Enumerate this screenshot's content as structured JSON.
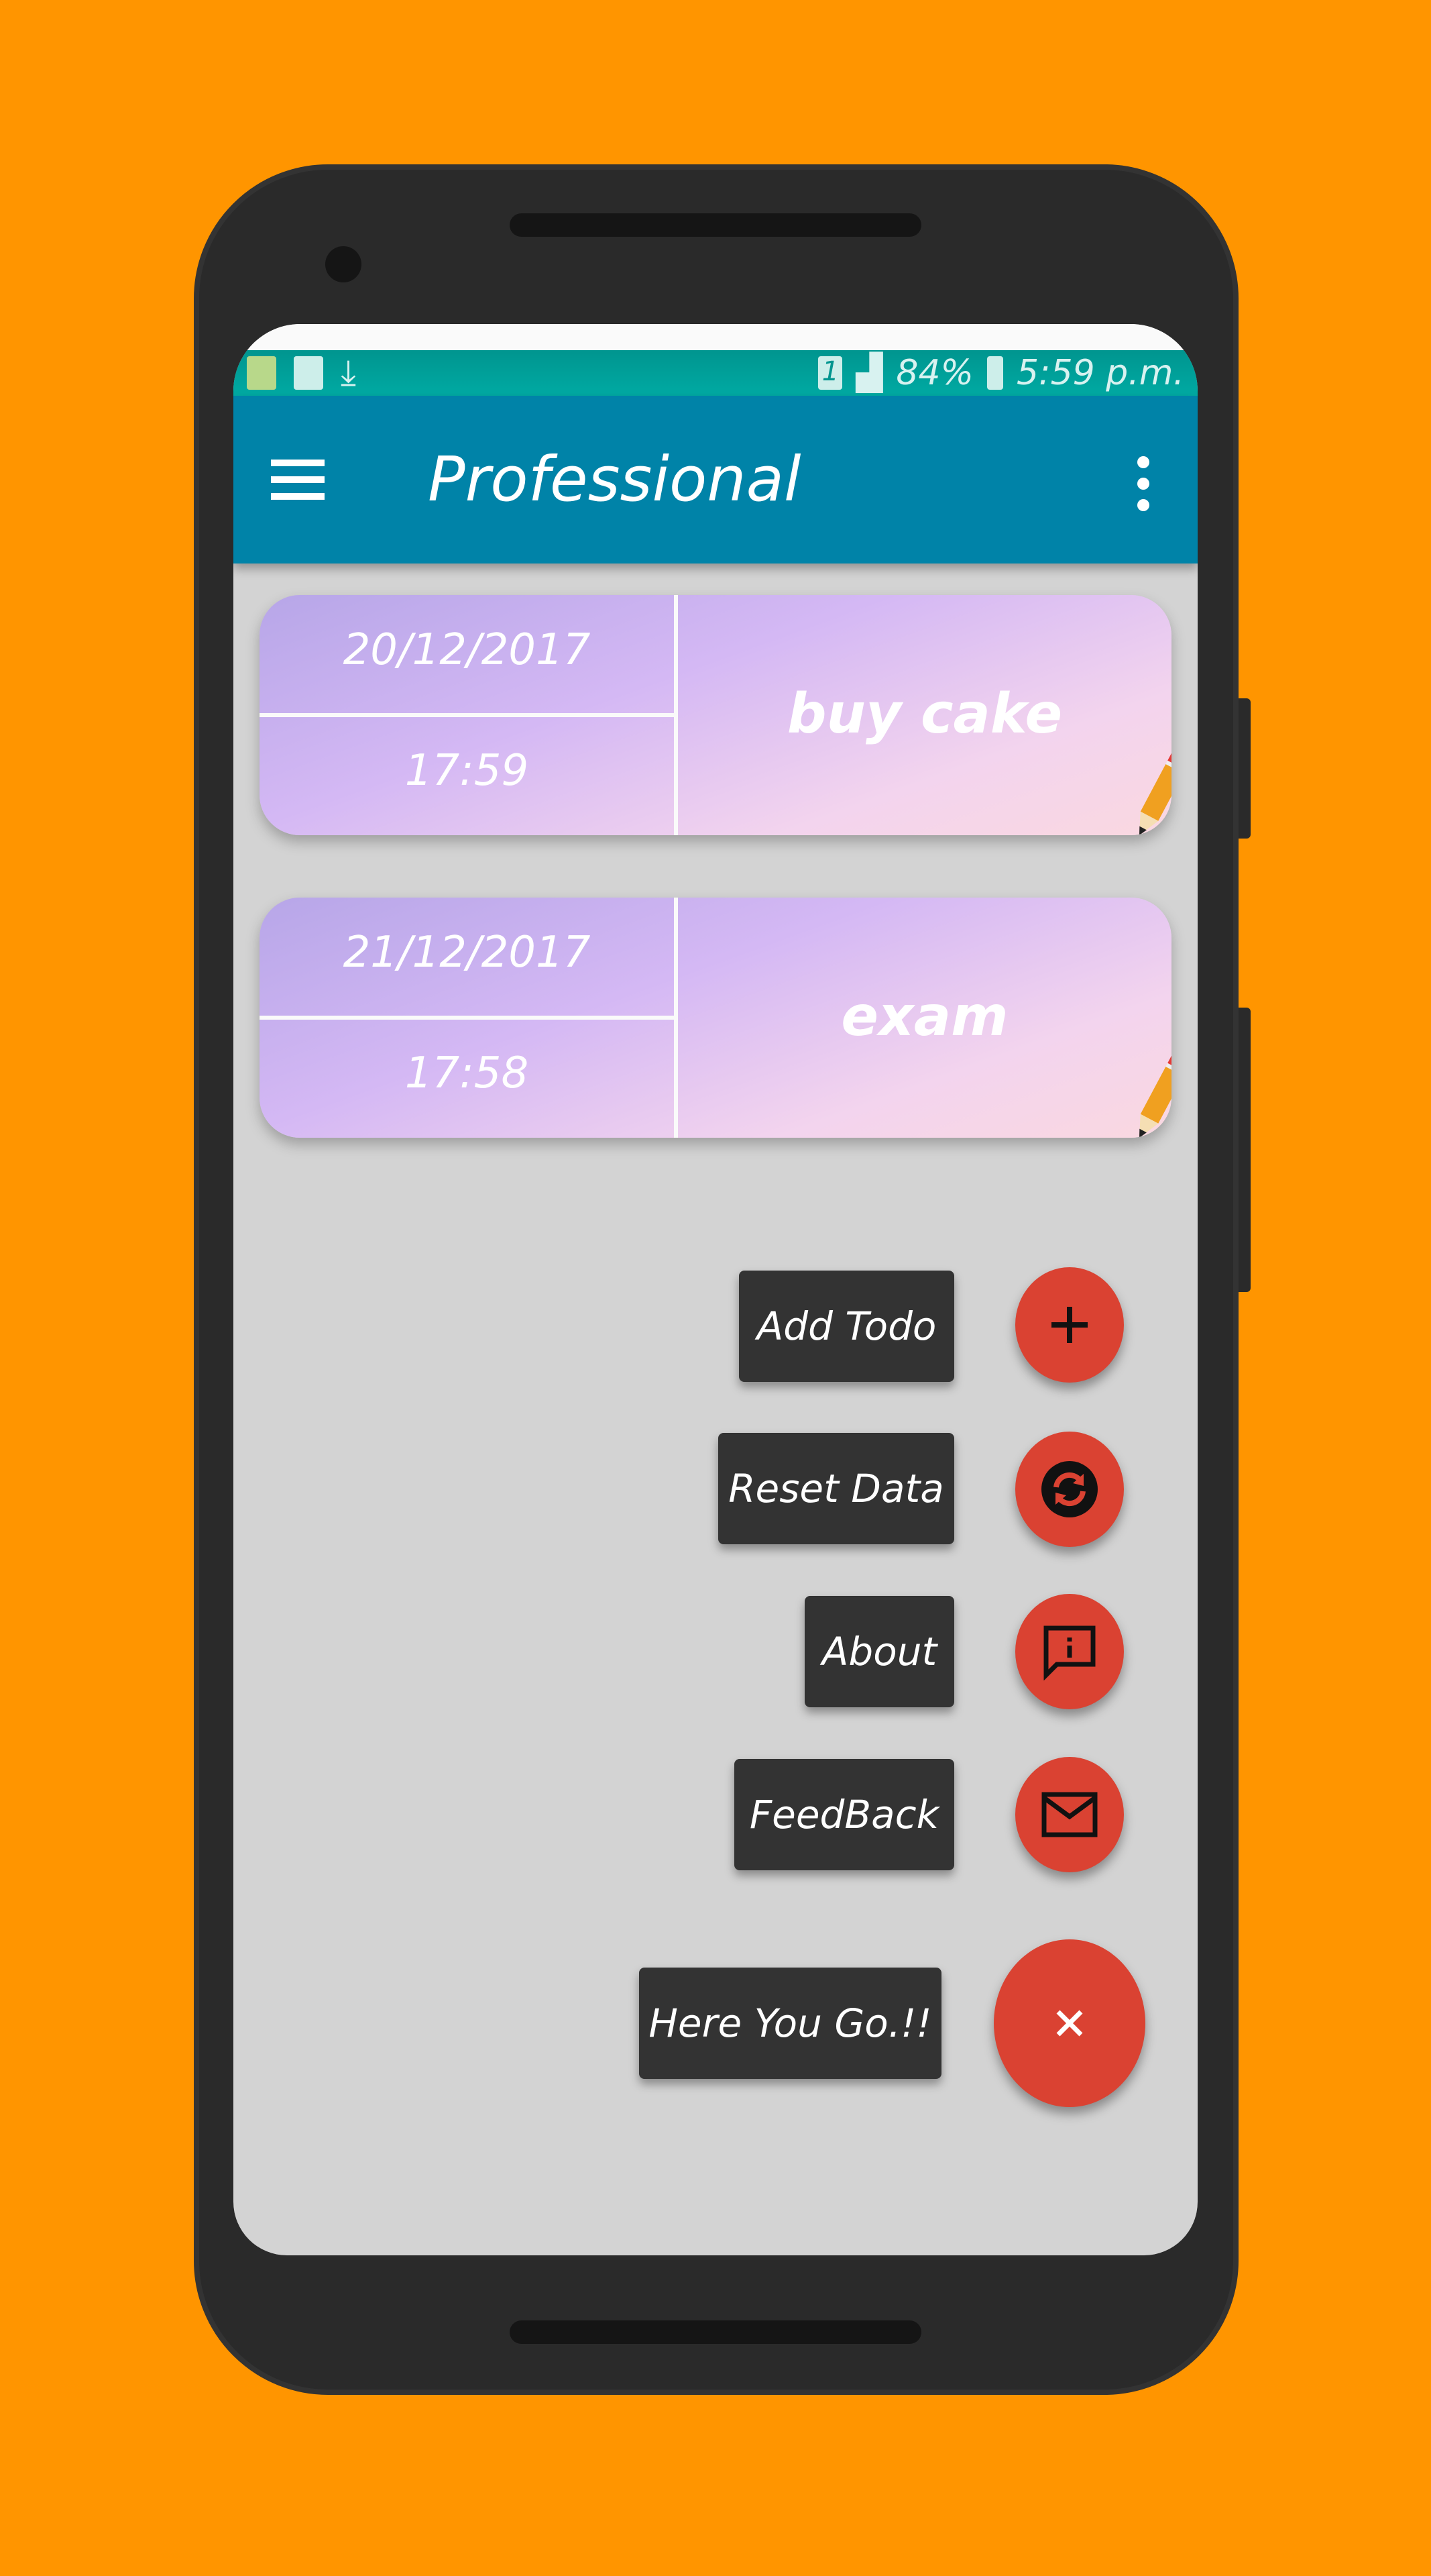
{
  "status_bar": {
    "battery": "84%",
    "time": "5:59 p.m.",
    "sim": "1"
  },
  "toolbar": {
    "title": "Professional"
  },
  "todos": [
    {
      "date": "20/12/2017",
      "time": "17:59",
      "task": "buy cake"
    },
    {
      "date": "21/12/2017",
      "time": "17:58",
      "task": "exam"
    }
  ],
  "fab_menu": {
    "items": [
      {
        "label": "Add Todo",
        "icon": "plus-icon"
      },
      {
        "label": "Reset Data",
        "icon": "refresh-icon"
      },
      {
        "label": "About",
        "icon": "info-message-icon"
      },
      {
        "label": "FeedBack",
        "icon": "mail-icon"
      }
    ],
    "main_label": "Here You Go.!!",
    "main_icon": "close-icon"
  },
  "colors": {
    "background": "#ff9500",
    "toolbar": "#0083a8",
    "status_bar": "#00aaa3",
    "fab": "#da4232",
    "label_bg": "#333333"
  }
}
